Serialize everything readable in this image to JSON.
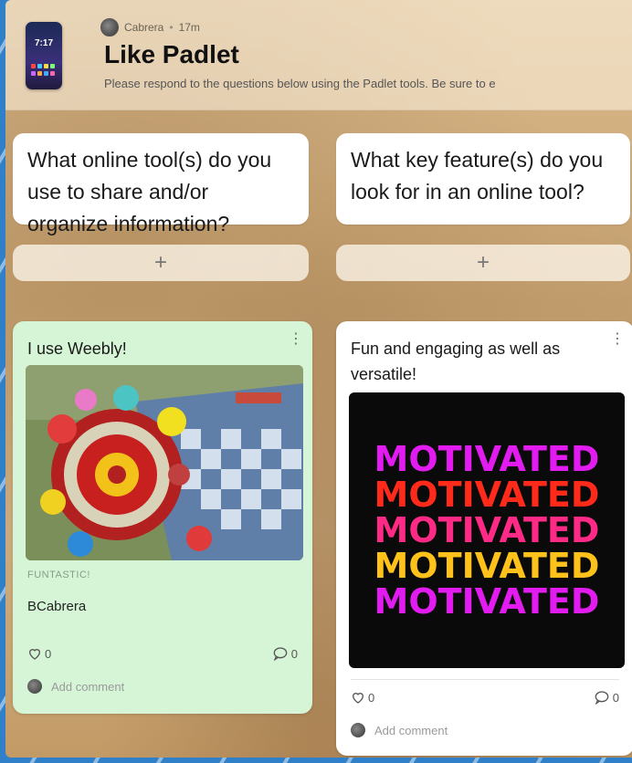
{
  "board": {
    "author": "Cabrera",
    "timestamp": "17m",
    "title": "Like Padlet",
    "description": "Please respond to the questions below using the Padlet tools. Be sure to e",
    "icon_time": "7:17"
  },
  "sections": [
    {
      "title": "What online tool(s) do you use to share and/or organize information?",
      "add_label": "+"
    },
    {
      "title": "What key feature(s) do you look for in an online tool?",
      "add_label": "+"
    }
  ],
  "posts": [
    {
      "title": "I use Weebly!",
      "attachment_label": "FUNTASTIC!",
      "body": "BCabrera",
      "likes": "0",
      "comments": "0",
      "add_comment": "Add comment",
      "menu": "⋮"
    },
    {
      "title": "Fun and engaging as well as versatile!",
      "gif_lines": [
        "MOTIVATED",
        "MOTIVATED",
        "MOTIVATED",
        "MOTIVATED",
        "MOTIVATED"
      ],
      "gif_colors": [
        "#e21cf0",
        "#ff2a1a",
        "#ff2a86",
        "#ffc21a",
        "#e21cf0"
      ],
      "likes": "0",
      "comments": "0",
      "add_comment": "Add comment",
      "menu": "⋮"
    }
  ],
  "icons": {
    "like": "heart-icon",
    "comment": "comment-bubble-icon",
    "more": "kebab-menu-icon",
    "add": "plus-icon"
  }
}
